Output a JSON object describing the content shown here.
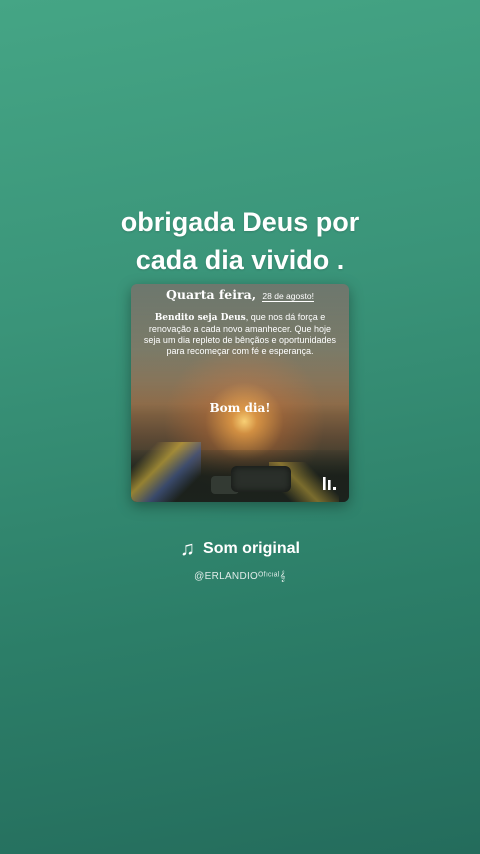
{
  "caption": {
    "line1": "obrigada Deus por",
    "line2": "cada dia vivido ."
  },
  "card": {
    "day": "Quarta feira,",
    "date": "28 de agosto!",
    "body_bold": "Bendito seja Deus",
    "body_rest": ", que nos dá força e renovação a cada novo amanhecer. Que hoje seja um dia repleto de bênçãos e oportunidades para recomeçar com fé e esperança.",
    "greeting": "Bom dia!",
    "brand_icon": "capcut-logo-icon"
  },
  "sound": {
    "icon": "music-note-icon",
    "label": "Som original"
  },
  "handle": "@ERLANDIOᴼᶠᶦᶜᶦᵃˡ𝄞",
  "colors": {
    "background_top": "#45a585",
    "background_bottom": "#246c5c"
  }
}
